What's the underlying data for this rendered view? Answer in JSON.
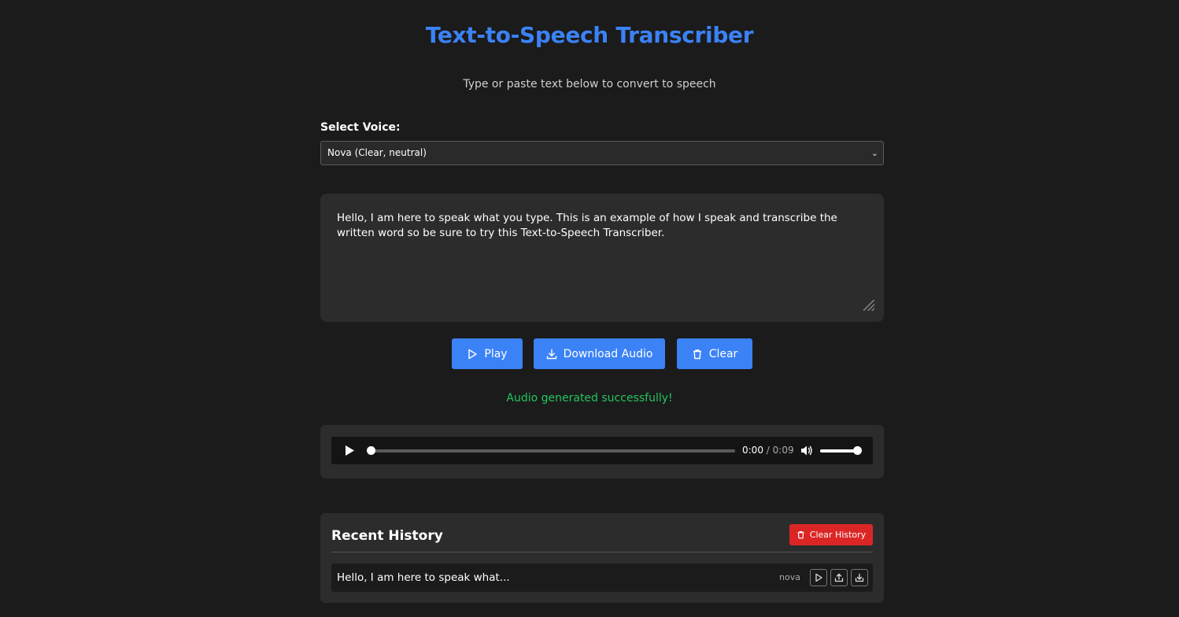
{
  "header": {
    "title": "Text-to-Speech Transcriber",
    "subtitle": "Type or paste text below to convert to speech"
  },
  "voice": {
    "label": "Select Voice:",
    "selected": "Nova (Clear, neutral)"
  },
  "text_input": {
    "value": "Hello, I am here to speak what you type. This is an example of how I speak and transcribe the written word so be sure to try this Text-to-Speech Transcriber."
  },
  "buttons": {
    "play": "Play",
    "download": "Download Audio",
    "clear": "Clear"
  },
  "status": "Audio generated successfully!",
  "player": {
    "current_time": "0:00",
    "duration": "/ 0:09",
    "progress": 0,
    "volume": 1
  },
  "history": {
    "title": "Recent History",
    "clear_label": "Clear History",
    "items": [
      {
        "text": "Hello, I am here to speak what...",
        "voice": "nova"
      }
    ]
  },
  "colors": {
    "accent": "#3b82f6",
    "danger": "#dc2626",
    "success": "#22c55e",
    "background": "#1b1b1b",
    "panel": "#2c2c2c"
  },
  "icons": {
    "play": "play-icon",
    "download": "download-icon",
    "clear": "trash-icon",
    "volume": "volume-icon",
    "share": "share-icon"
  }
}
